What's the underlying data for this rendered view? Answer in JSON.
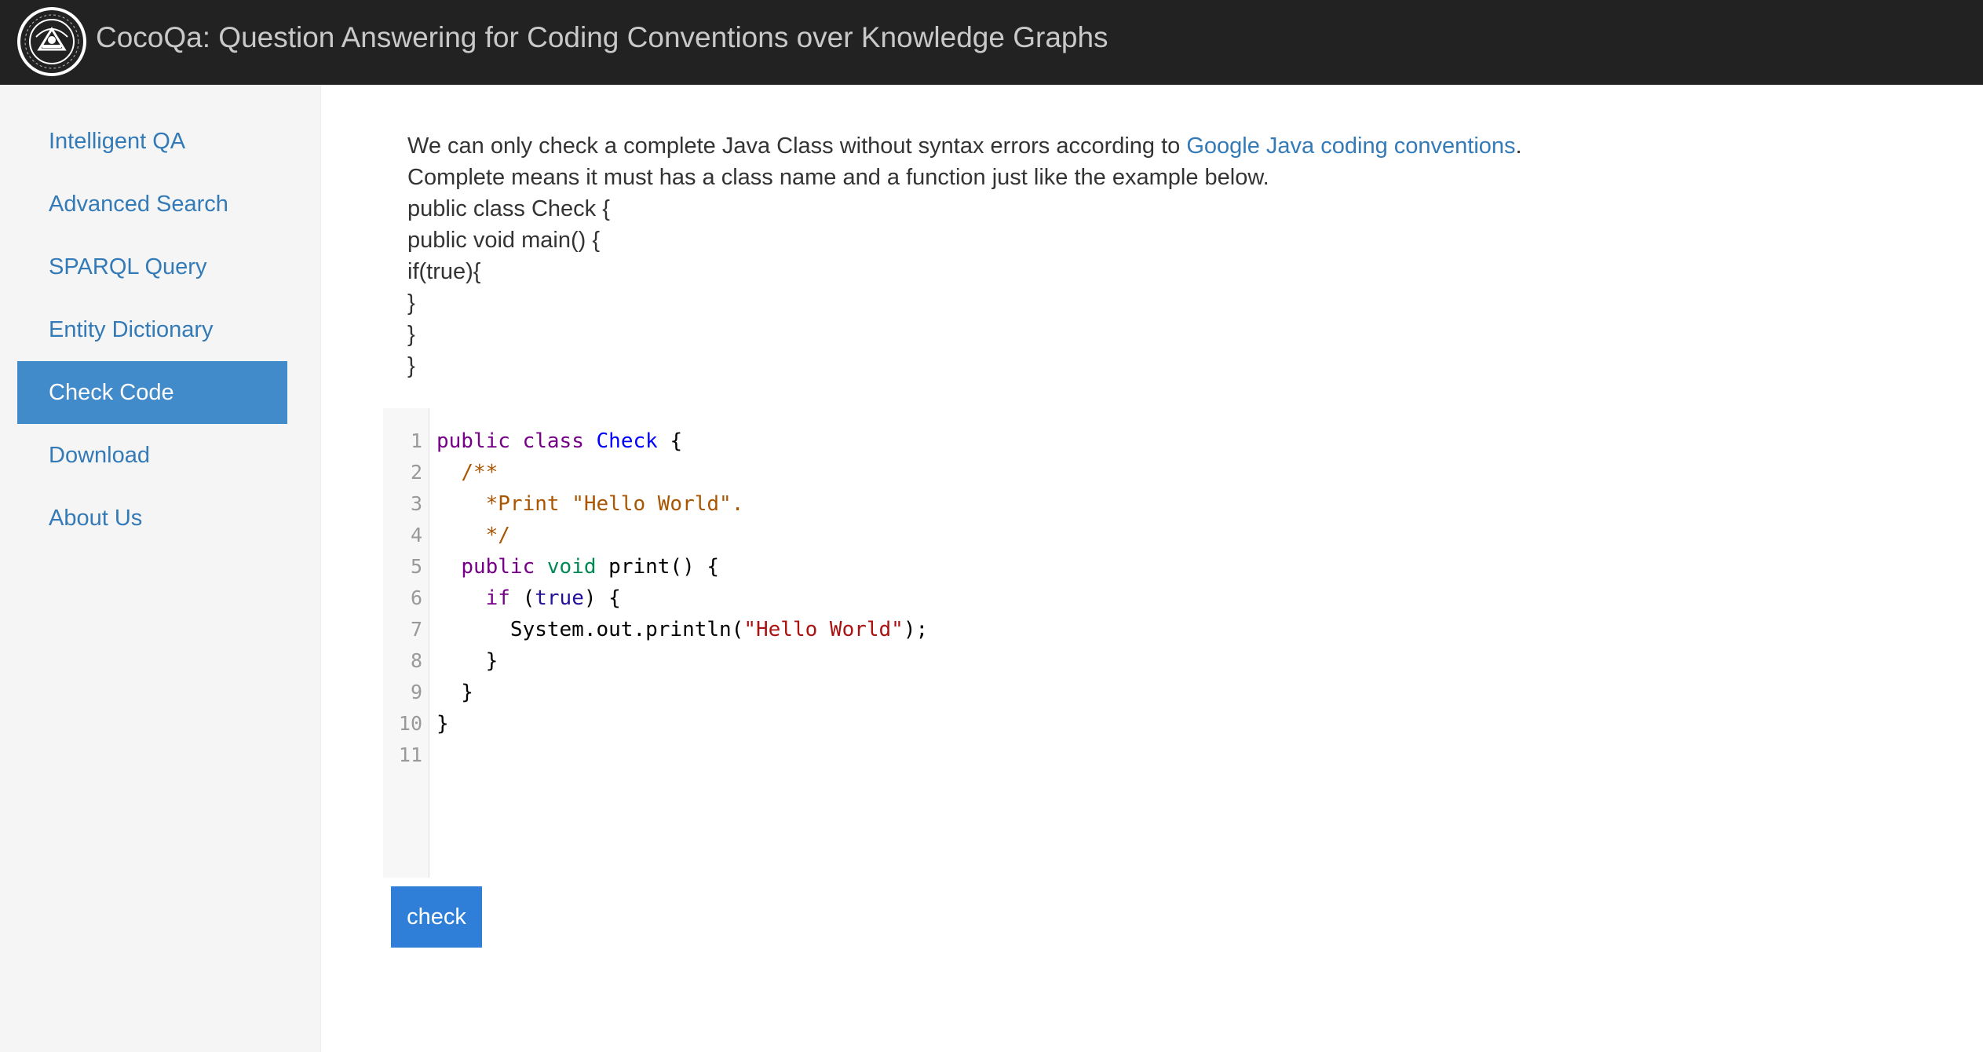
{
  "header": {
    "title": "CocoQa: Question Answering for Coding Conventions over Knowledge Graphs"
  },
  "sidebar": {
    "items": [
      {
        "label": "Intelligent QA",
        "active": false
      },
      {
        "label": "Advanced Search",
        "active": false
      },
      {
        "label": "SPARQL Query",
        "active": false
      },
      {
        "label": "Entity Dictionary",
        "active": false
      },
      {
        "label": "Check Code",
        "active": true
      },
      {
        "label": "Download",
        "active": false
      },
      {
        "label": "About Us",
        "active": false
      }
    ]
  },
  "intro": {
    "line1_prefix": "We can only check a complete Java Class without syntax errors according to ",
    "line1_link": "Google Java coding conventions",
    "line1_suffix": ".",
    "line2": "Complete means it must has a class name and a function just like the example below.",
    "example": [
      "public class Check {",
      "public void main() {",
      "if(true){",
      "}",
      "}",
      "}"
    ]
  },
  "editor": {
    "line_numbers": [
      "1",
      "2",
      "3",
      "4",
      "5",
      "6",
      "7",
      "8",
      "9",
      "10",
      "11"
    ],
    "lines": [
      [
        {
          "t": "public",
          "c": "kw"
        },
        {
          "t": " "
        },
        {
          "t": "class",
          "c": "kw"
        },
        {
          "t": " "
        },
        {
          "t": "Check",
          "c": "def"
        },
        {
          "t": " {"
        }
      ],
      [
        {
          "t": "  "
        },
        {
          "t": "/**",
          "c": "cmt"
        }
      ],
      [
        {
          "t": "    "
        },
        {
          "t": "*Print \"Hello World\".",
          "c": "cmt"
        }
      ],
      [
        {
          "t": "    "
        },
        {
          "t": "*/",
          "c": "cmt"
        }
      ],
      [
        {
          "t": "  "
        },
        {
          "t": "public",
          "c": "kw"
        },
        {
          "t": " "
        },
        {
          "t": "void",
          "c": "type"
        },
        {
          "t": " print() {"
        }
      ],
      [
        {
          "t": "    "
        },
        {
          "t": "if",
          "c": "kw"
        },
        {
          "t": " ("
        },
        {
          "t": "true",
          "c": "atom"
        },
        {
          "t": ") {"
        }
      ],
      [
        {
          "t": "      System.out.println("
        },
        {
          "t": "\"Hello World\"",
          "c": "str"
        },
        {
          "t": ");"
        }
      ],
      [
        {
          "t": "    }"
        }
      ],
      [
        {
          "t": "  }"
        }
      ],
      [
        {
          "t": "}"
        }
      ],
      []
    ]
  },
  "actions": {
    "check_label": "check"
  },
  "colors": {
    "topbar": "#222222",
    "link": "#337ab7",
    "active_nav": "#428bca",
    "button": "#2f7fd8"
  }
}
